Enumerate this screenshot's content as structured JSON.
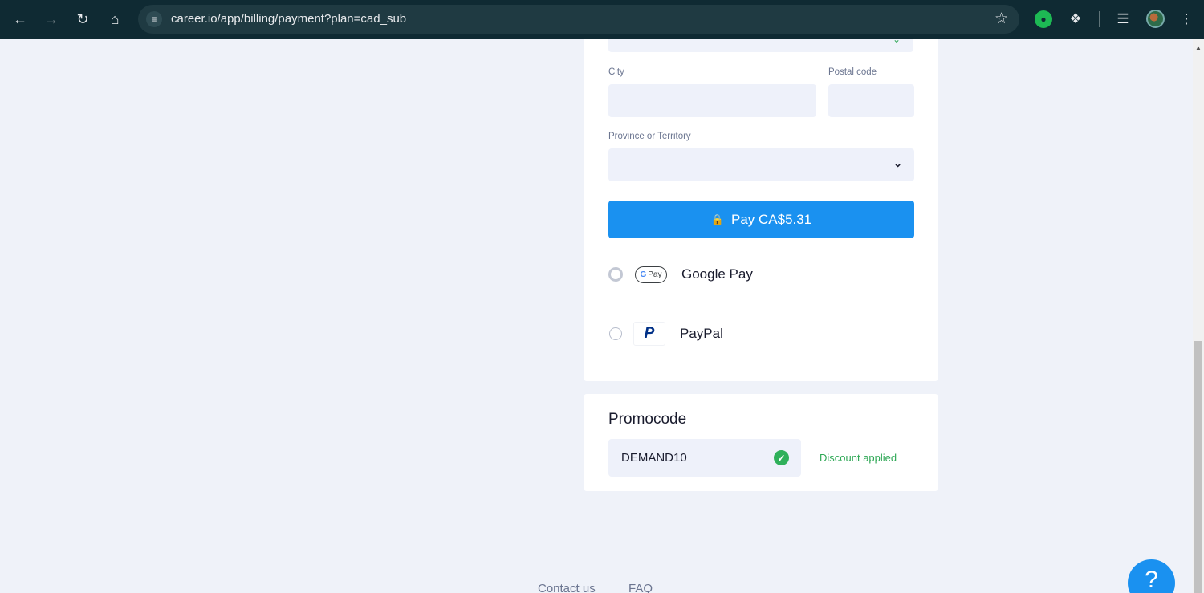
{
  "browser": {
    "url": "career.io/app/billing/payment?plan=cad_sub",
    "icons": {
      "back": "arrow-left-icon",
      "forward": "arrow-right-icon",
      "reload": "reload-icon",
      "home": "home-icon",
      "site_info": "tune-icon",
      "bookmark": "star-icon",
      "extension_green": "grammarly-icon",
      "extensions": "puzzle-icon",
      "media": "media-queue-icon",
      "menu": "kebab-menu-icon"
    }
  },
  "billing_form": {
    "city_label": "City",
    "city_value": "",
    "postal_label": "Postal code",
    "postal_value": "",
    "province_label": "Province or Territory",
    "province_value": ""
  },
  "pay_button": {
    "label": "Pay CA$5.31",
    "color": "#1a91f0"
  },
  "payment_methods": [
    {
      "label": "Google Pay",
      "logo_text": "Pay",
      "logo_g": "G",
      "selected": false
    },
    {
      "label": "PayPal",
      "logo_text": "P",
      "selected": false
    }
  ],
  "promo": {
    "title": "Promocode",
    "code": "DEMAND10",
    "status": "Discount applied",
    "status_color": "#2fa856"
  },
  "footer": {
    "contact": "Contact us",
    "faq": "FAQ"
  },
  "help_button": {
    "label": "?"
  }
}
